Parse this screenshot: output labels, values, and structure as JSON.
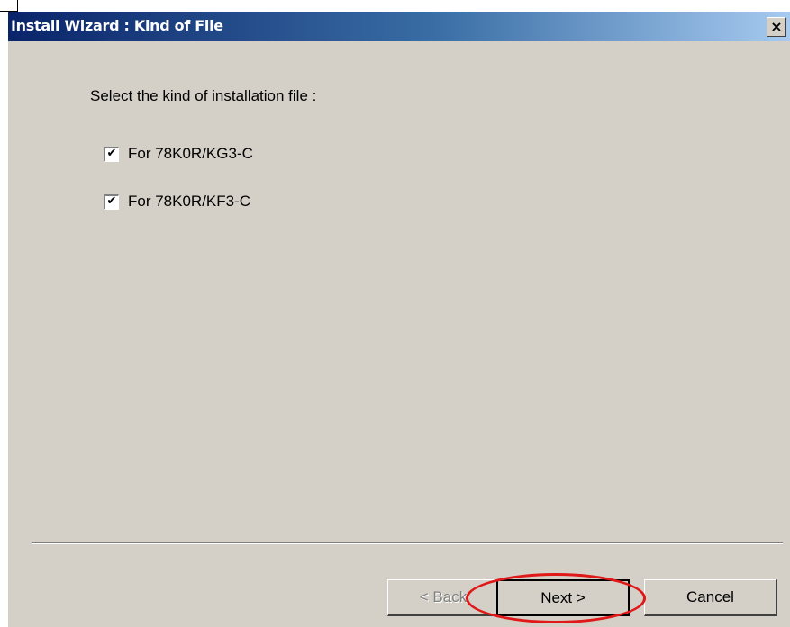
{
  "window": {
    "title": "Install Wizard : Kind of File",
    "close_glyph": "×",
    "close_icon": "close-icon"
  },
  "content": {
    "instruction": "Select the kind of installation file :",
    "options": [
      {
        "label": "For 78K0R/KG3-C",
        "checked": true
      },
      {
        "label": "For 78K0R/KF3-C",
        "checked": true
      }
    ],
    "check_glyph": "✔"
  },
  "buttons": {
    "back_label": "< Back",
    "back_enabled": false,
    "next_label": "Next >",
    "cancel_label": "Cancel"
  },
  "colors": {
    "titlebar_start": "#0a246a",
    "titlebar_end": "#a6caf0",
    "window_face": "#d4d0c8",
    "highlight_ring": "#e01818",
    "disabled_text": "#808080"
  }
}
